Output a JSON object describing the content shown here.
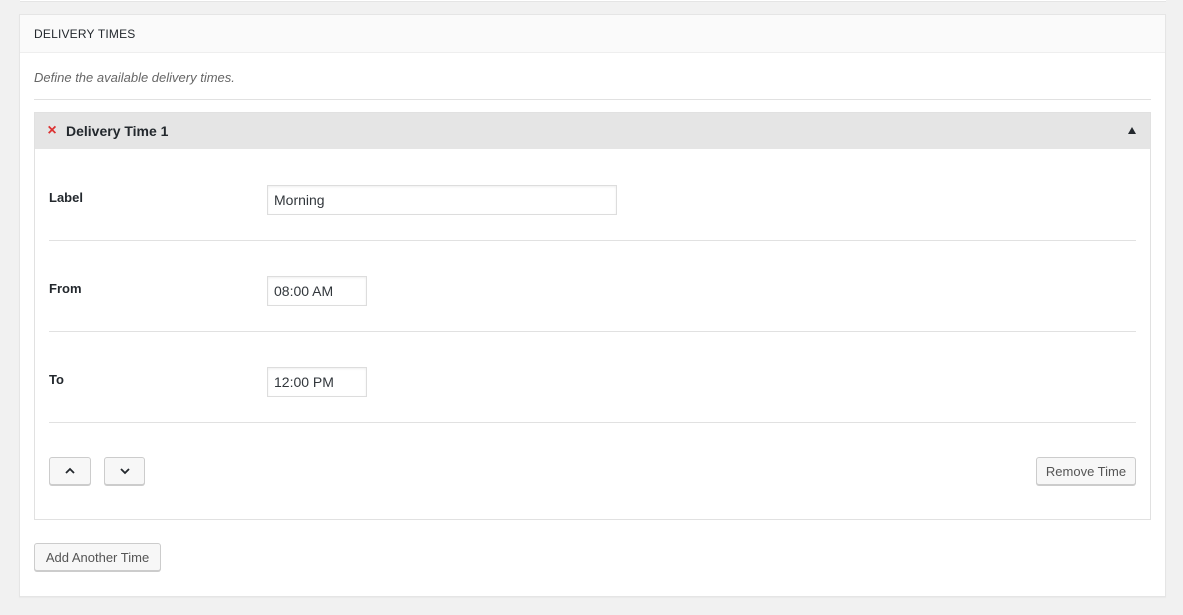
{
  "panel": {
    "title": "DELIVERY TIMES",
    "description": "Define the available delivery times."
  },
  "group": {
    "title": "Delivery Time 1",
    "remove_icon": "×",
    "fields": {
      "label": {
        "label": "Label",
        "value": "Morning"
      },
      "from": {
        "label": "From",
        "value": "08:00 AM"
      },
      "to": {
        "label": "To",
        "value": "12:00 PM"
      }
    },
    "remove_button": "Remove Time"
  },
  "add_button": "Add Another Time",
  "icons": {
    "remove": "close-x-icon",
    "collapse": "triangle-up-icon",
    "move_up": "chevron-up-icon",
    "move_down": "chevron-down-icon"
  },
  "colors": {
    "remove_icon": "#dc3232",
    "group_header_bg": "#e5e5e5",
    "page_bg": "#f1f1f1"
  }
}
